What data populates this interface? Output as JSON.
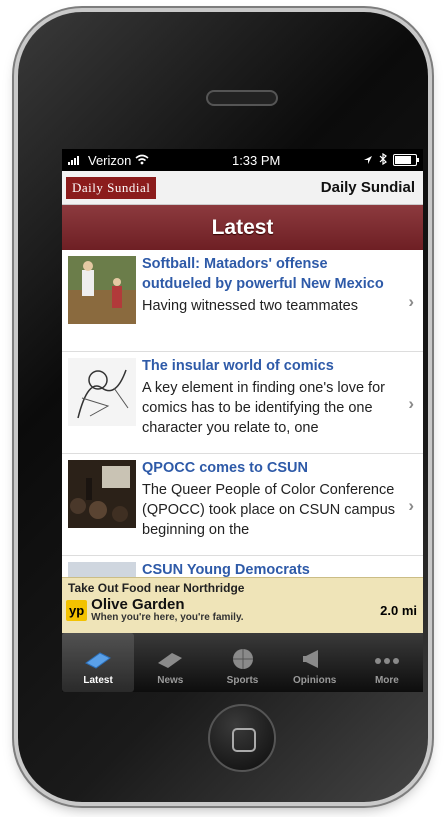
{
  "status": {
    "carrier": "Verizon",
    "time": "1:33 PM",
    "battery": 0.9
  },
  "brand": {
    "logo_text": "Daily Sundial",
    "title": "Daily Sundial"
  },
  "section": {
    "title": "Latest"
  },
  "articles": [
    {
      "headline": "Softball: Matadors' offense outdueled by powerful New Mexico",
      "summary": "Having witnessed two teammates"
    },
    {
      "headline": "The insular world of comics",
      "summary": "A key element in finding one's love for comics has to be identifying the one character you relate to, one"
    },
    {
      "headline": "QPOCC comes to CSUN",
      "summary": "The Queer People of Color Conference (QPOCC) took place on CSUN campus beginning on the"
    },
    {
      "headline": "CSUN Young Democrats",
      "summary": ""
    }
  ],
  "ad": {
    "top": "Take Out Food near Northridge",
    "brand_badge": "yp",
    "name": "Olive Garden",
    "tagline": "When you're here, you're family.",
    "distance": "2.0 mi"
  },
  "tabs": [
    {
      "label": "Latest",
      "icon": "newspaper-icon"
    },
    {
      "label": "News",
      "icon": "newspaper-icon"
    },
    {
      "label": "Sports",
      "icon": "basketball-icon"
    },
    {
      "label": "Opinions",
      "icon": "megaphone-icon"
    },
    {
      "label": "More",
      "icon": "more-dots-icon"
    }
  ],
  "colors": {
    "brand": "#8b1c1c",
    "link": "#2e5aa8",
    "ad_bg": "#efe4b8"
  }
}
